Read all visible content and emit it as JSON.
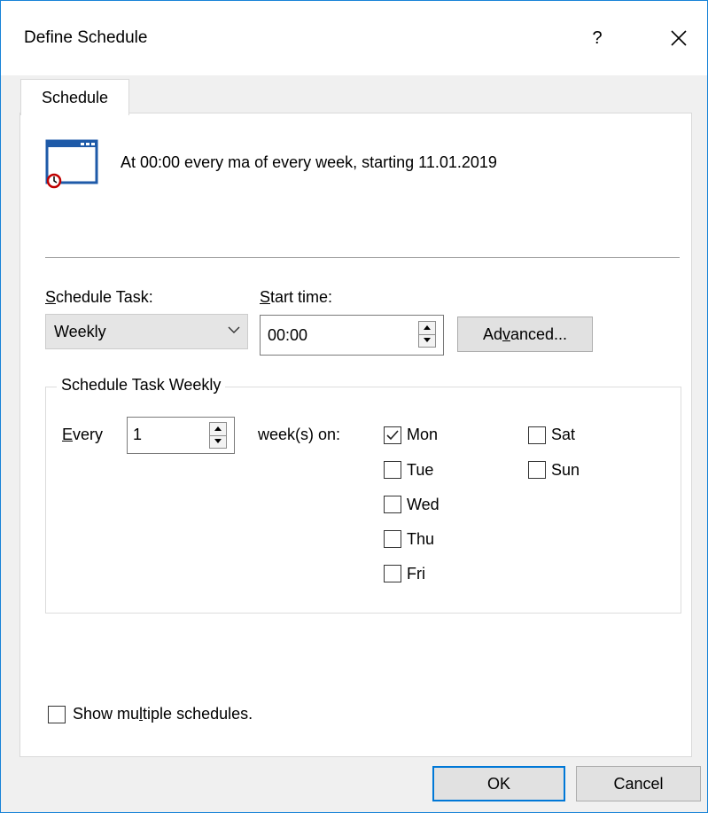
{
  "window": {
    "title": "Define Schedule",
    "help_label": "?",
    "close_icon": "close-icon"
  },
  "tabs": [
    {
      "label": "Schedule",
      "active": true
    }
  ],
  "summary": {
    "icon": "schedule-clock-icon",
    "text": "At 00:00 every ma of every week, starting 11.01.2019"
  },
  "schedule_task": {
    "label_prefix": "",
    "label_mnemonic": "S",
    "label_rest": "chedule Task:",
    "selected": "Weekly"
  },
  "start_time": {
    "label_mnemonic": "S",
    "label_rest": "tart time:",
    "value": "00:00"
  },
  "advanced_button": {
    "before": "Ad",
    "mnemonic": "v",
    "after": "anced..."
  },
  "weekly_group": {
    "legend": "Schedule Task Weekly",
    "every_mnemonic": "E",
    "every_rest": "very",
    "every_value": "1",
    "weeks_on_label": "week(s) on:",
    "days": [
      {
        "label": "Mon",
        "checked": true
      },
      {
        "label": "Tue",
        "checked": false
      },
      {
        "label": "Wed",
        "checked": false
      },
      {
        "label": "Thu",
        "checked": false
      },
      {
        "label": "Fri",
        "checked": false
      },
      {
        "label": "Sat",
        "checked": false
      },
      {
        "label": "Sun",
        "checked": false
      }
    ]
  },
  "show_multiple": {
    "before": "Show mu",
    "mnemonic": "l",
    "after": "tiple schedules.",
    "checked": false
  },
  "footer": {
    "ok_label": "OK",
    "cancel_label": "Cancel"
  },
  "colors": {
    "accent": "#0078d7",
    "window_border": "#1883d7",
    "clock_red": "#c00000",
    "icon_blue": "#1e5aa8"
  }
}
